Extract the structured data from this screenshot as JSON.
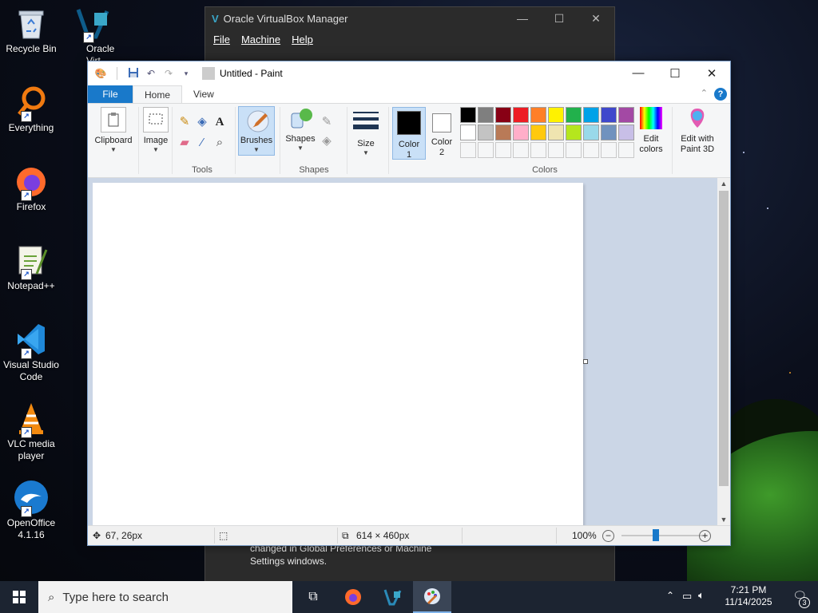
{
  "desktop": {
    "icons": [
      {
        "label": "Recycle Bin"
      },
      {
        "label": "Oracle Virt"
      },
      {
        "label": "Everything"
      },
      {
        "label": "Firefox"
      },
      {
        "label": "Notepad++"
      },
      {
        "label": "Visual Studio Code"
      },
      {
        "label": "VLC media player"
      },
      {
        "label": "OpenOffice 4.1.16"
      }
    ]
  },
  "vbox": {
    "title": "Oracle VirtualBox Manager",
    "menu": [
      "File",
      "Machine",
      "Help"
    ],
    "message_line1": "changed in Global Preferences or Machine",
    "message_line2": "Settings windows."
  },
  "paint": {
    "title": "Untitled - Paint",
    "tabs": {
      "file": "File",
      "home": "Home",
      "view": "View"
    },
    "groups": {
      "clipboard": "Clipboard",
      "image": "Image",
      "tools": "Tools",
      "brushes": "Brushes",
      "shapes_btn": "Shapes",
      "shapes": "Shapes",
      "size": "Size",
      "color1_a": "Color",
      "color1_b": "1",
      "color2_a": "Color",
      "color2_b": "2",
      "colors": "Colors",
      "edit_colors_a": "Edit",
      "edit_colors_b": "colors",
      "paint3d_a": "Edit with",
      "paint3d_b": "Paint 3D"
    },
    "palette_row1": [
      "#000000",
      "#7f7f7f",
      "#880015",
      "#ed1c24",
      "#ff7f27",
      "#fff200",
      "#22b14c",
      "#00a2e8",
      "#3f48cc",
      "#a349a4"
    ],
    "palette_row2": [
      "#ffffff",
      "#c3c3c3",
      "#b97a57",
      "#ffaec9",
      "#ffc90e",
      "#efe4b0",
      "#b5e61d",
      "#99d9ea",
      "#7092be",
      "#c8bfe7"
    ],
    "color1": "#000000",
    "color2": "#ffffff",
    "status": {
      "cursor": "67, 26px",
      "size": "614 × 460px",
      "zoom": "100%"
    }
  },
  "taskbar": {
    "search_placeholder": "Type here to search",
    "time": "7:21 PM",
    "date": "11/14/2025",
    "notifications": "3"
  }
}
